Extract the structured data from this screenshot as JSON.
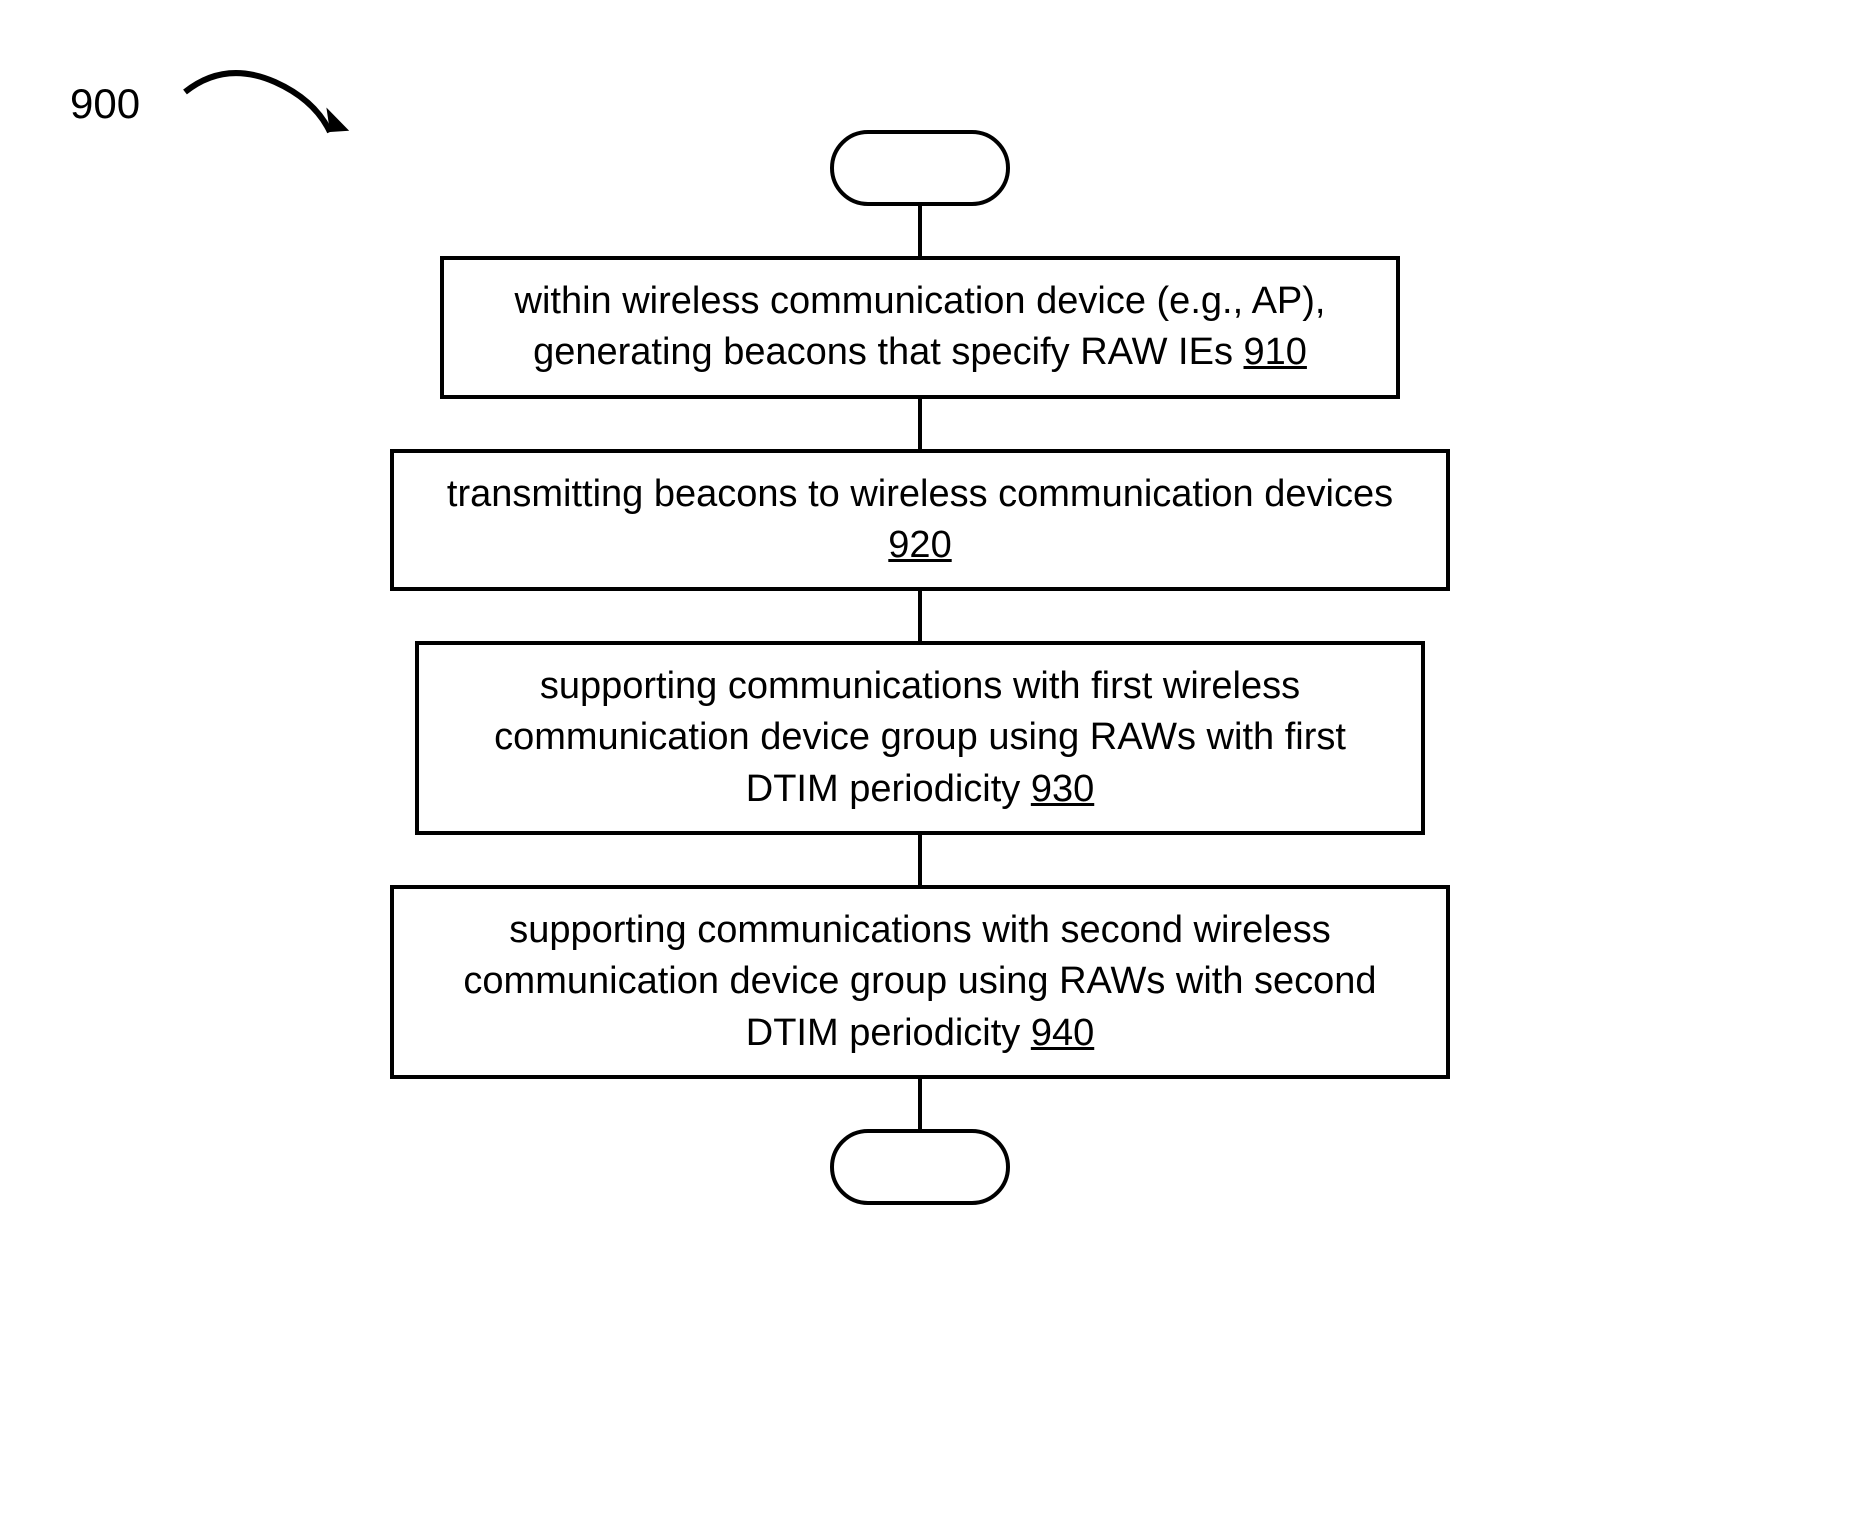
{
  "figure_label": "900",
  "boxes": {
    "b910": {
      "text": "within wireless communication device (e.g., AP), generating beacons that specify RAW IEs ",
      "ref": "910"
    },
    "b920": {
      "text": "transmitting beacons to wireless communication devices ",
      "ref": "920"
    },
    "b930": {
      "text": "supporting communications with first wireless communication device group using RAWs with first DTIM periodicity ",
      "ref": "930"
    },
    "b940": {
      "text": "supporting communications with second wireless communication device group using RAWs with second DTIM periodicity ",
      "ref": "940"
    }
  }
}
